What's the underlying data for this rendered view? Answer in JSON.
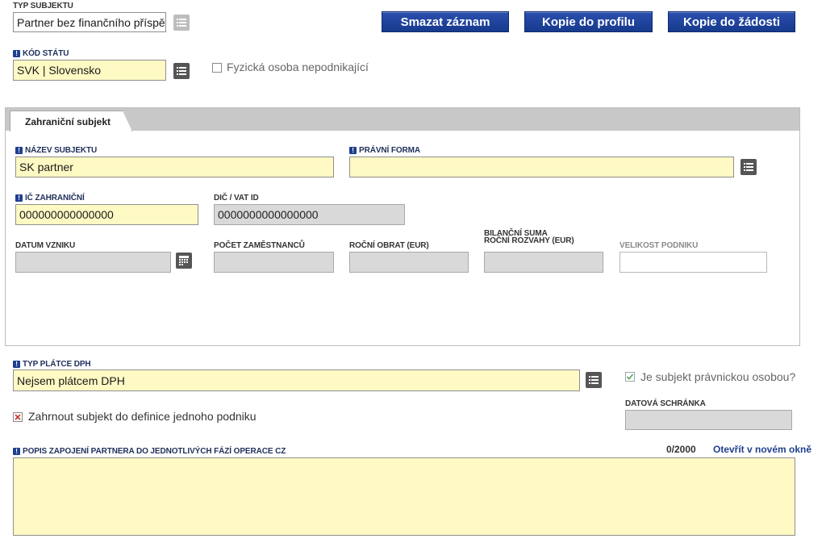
{
  "top": {
    "typ_subjektu_label": "TYP SUBJEKTU",
    "typ_subjektu_value": "Partner bez finančního příspěvku",
    "kod_statu_label": "KÓD STÁTU",
    "kod_statu_value": "SVK | Slovensko",
    "fyzicka_osoba_label": "Fyzická osoba nepodnikající",
    "buttons": {
      "smazat": "Smazat záznam",
      "kopie_profil": "Kopie do profilu",
      "kopie_zadost": "Kopie do žádosti"
    }
  },
  "panel": {
    "tab_label": "Zahraniční subjekt",
    "nazev_label": "NÁZEV SUBJEKTU",
    "nazev_value": "SK partner",
    "pravni_forma_label": "PRÁVNÍ FORMA",
    "pravni_forma_value": "",
    "ic_label": "IČ ZAHRANIČNÍ",
    "ic_value": "000000000000000",
    "dic_label": "DIČ / VAT ID",
    "dic_value": "0000000000000000",
    "datum_label": "DATUM VZNIKU",
    "pocet_label": "POČET ZAMĚSTNANCŮ",
    "obrat_label": "ROČNÍ OBRAT (EUR)",
    "bilancni_label_1": "BILANČNÍ SUMA",
    "bilancni_label_2": "ROČNÍ ROZVAHY (EUR)",
    "velikost_label": "VELIKOST PODNIKU"
  },
  "bottom": {
    "typ_platce_label": "TYP PLÁTCE DPH",
    "typ_platce_value": "Nejsem plátcem DPH",
    "pravnicka_label": "Je subjekt právnickou osobou?",
    "pravnicka_checked": true,
    "datova_label": "DATOVÁ SCHRÁNKA",
    "zahrnout_label": "Zahrnout subjekt do definice jednoho podniku",
    "zahrnout_state": "x",
    "popis_label": "POPIS ZAPOJENÍ PARTNERA DO JEDNOTLIVÝCH FÁZÍ OPERACE CZ",
    "counter": "0/2000",
    "open_link": "Otevřít v novém okně"
  },
  "colors": {
    "required_bg": "#fff9c4",
    "readonly_bg": "#d9d9d9",
    "button_blue": "#1f3f8f",
    "label_blue": "#1f2f5a"
  }
}
